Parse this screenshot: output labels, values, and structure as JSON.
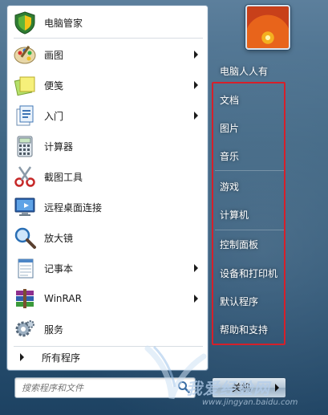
{
  "programs": [
    {
      "label": "电脑管家",
      "icon": "shield-icon",
      "arrow": false
    },
    {
      "label": "画图",
      "icon": "paint-palette-icon",
      "arrow": true
    },
    {
      "label": "便笺",
      "icon": "sticky-note-icon",
      "arrow": true
    },
    {
      "label": "入门",
      "icon": "getting-started-icon",
      "arrow": true
    },
    {
      "label": "计算器",
      "icon": "calculator-icon",
      "arrow": false
    },
    {
      "label": "截图工具",
      "icon": "scissors-icon",
      "arrow": false
    },
    {
      "label": "远程桌面连接",
      "icon": "remote-desktop-icon",
      "arrow": false
    },
    {
      "label": "放大镜",
      "icon": "magnifier-icon",
      "arrow": false
    },
    {
      "label": "记事本",
      "icon": "notepad-icon",
      "arrow": true
    },
    {
      "label": "WinRAR",
      "icon": "winrar-icon",
      "arrow": true
    },
    {
      "label": "服务",
      "icon": "services-gear-icon",
      "arrow": false
    }
  ],
  "all_programs": "所有程序",
  "search": {
    "placeholder": "搜索程序和文件"
  },
  "user": {
    "name": "电脑人人有"
  },
  "right_items": [
    "文档",
    "图片",
    "音乐",
    "游戏",
    "计算机",
    "控制面板",
    "设备和打印机",
    "默认程序",
    "帮助和支持"
  ],
  "shutdown": {
    "label": "关机"
  },
  "watermark": {
    "text": "我爱经验网",
    "url": "www.jingyan.baidu.com"
  },
  "colors": {
    "highlight_box": "#d6202a"
  }
}
